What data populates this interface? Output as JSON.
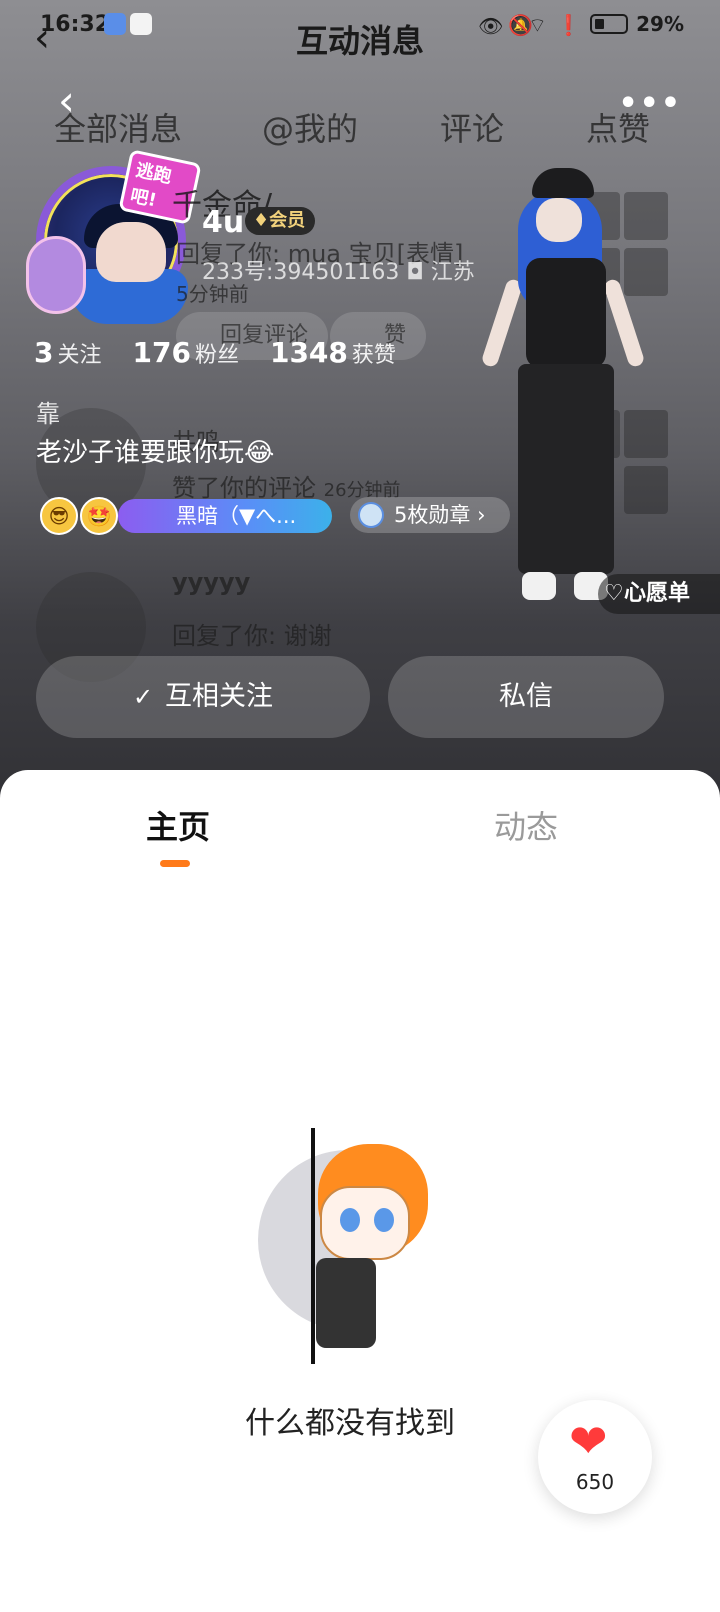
{
  "status_bar": {
    "time": "16:32",
    "battery": "29%"
  },
  "overlay": {
    "title": "互动消息",
    "tabs": [
      "全部消息",
      "@我的",
      "评论",
      "点赞"
    ],
    "ghost_name": "千金命/",
    "ghost_reply": "回复了你: mua 宝贝[表情]",
    "ghost_time": "5分钟前",
    "ghost_btn1": "回复评论",
    "ghost_btn2": "赞",
    "ghost_user2": "共鸣",
    "ghost_action2": "赞了你的评论",
    "ghost_time2": "26分钟前",
    "ghost_user3": "yyyyy",
    "ghost_reply3": "回复了你: 谢谢"
  },
  "profile": {
    "avatar_frame_text": "逃跑吧!",
    "username": "4u",
    "vip_label": "会员",
    "uid": "233号:394501163",
    "location": "江苏",
    "stats": [
      {
        "num": "3",
        "label": "关注"
      },
      {
        "num": "176",
        "label": "粉丝"
      },
      {
        "num": "1348",
        "label": "获赞"
      }
    ],
    "bio_line1": "靠",
    "bio_line2": "老沙子谁要跟你玩😂",
    "title_badge": "黑暗（▼へ...",
    "medal_badge": "5枚勋章",
    "wishlist": "心愿单",
    "follow_button": "互相关注",
    "message_button": "私信"
  },
  "sheet": {
    "tabs": [
      "主页",
      "动态"
    ],
    "empty_text": "什么都没有找到",
    "like_count": "650"
  },
  "colors": {
    "accent": "#ff7a1a",
    "like": "#ff3b3b"
  }
}
